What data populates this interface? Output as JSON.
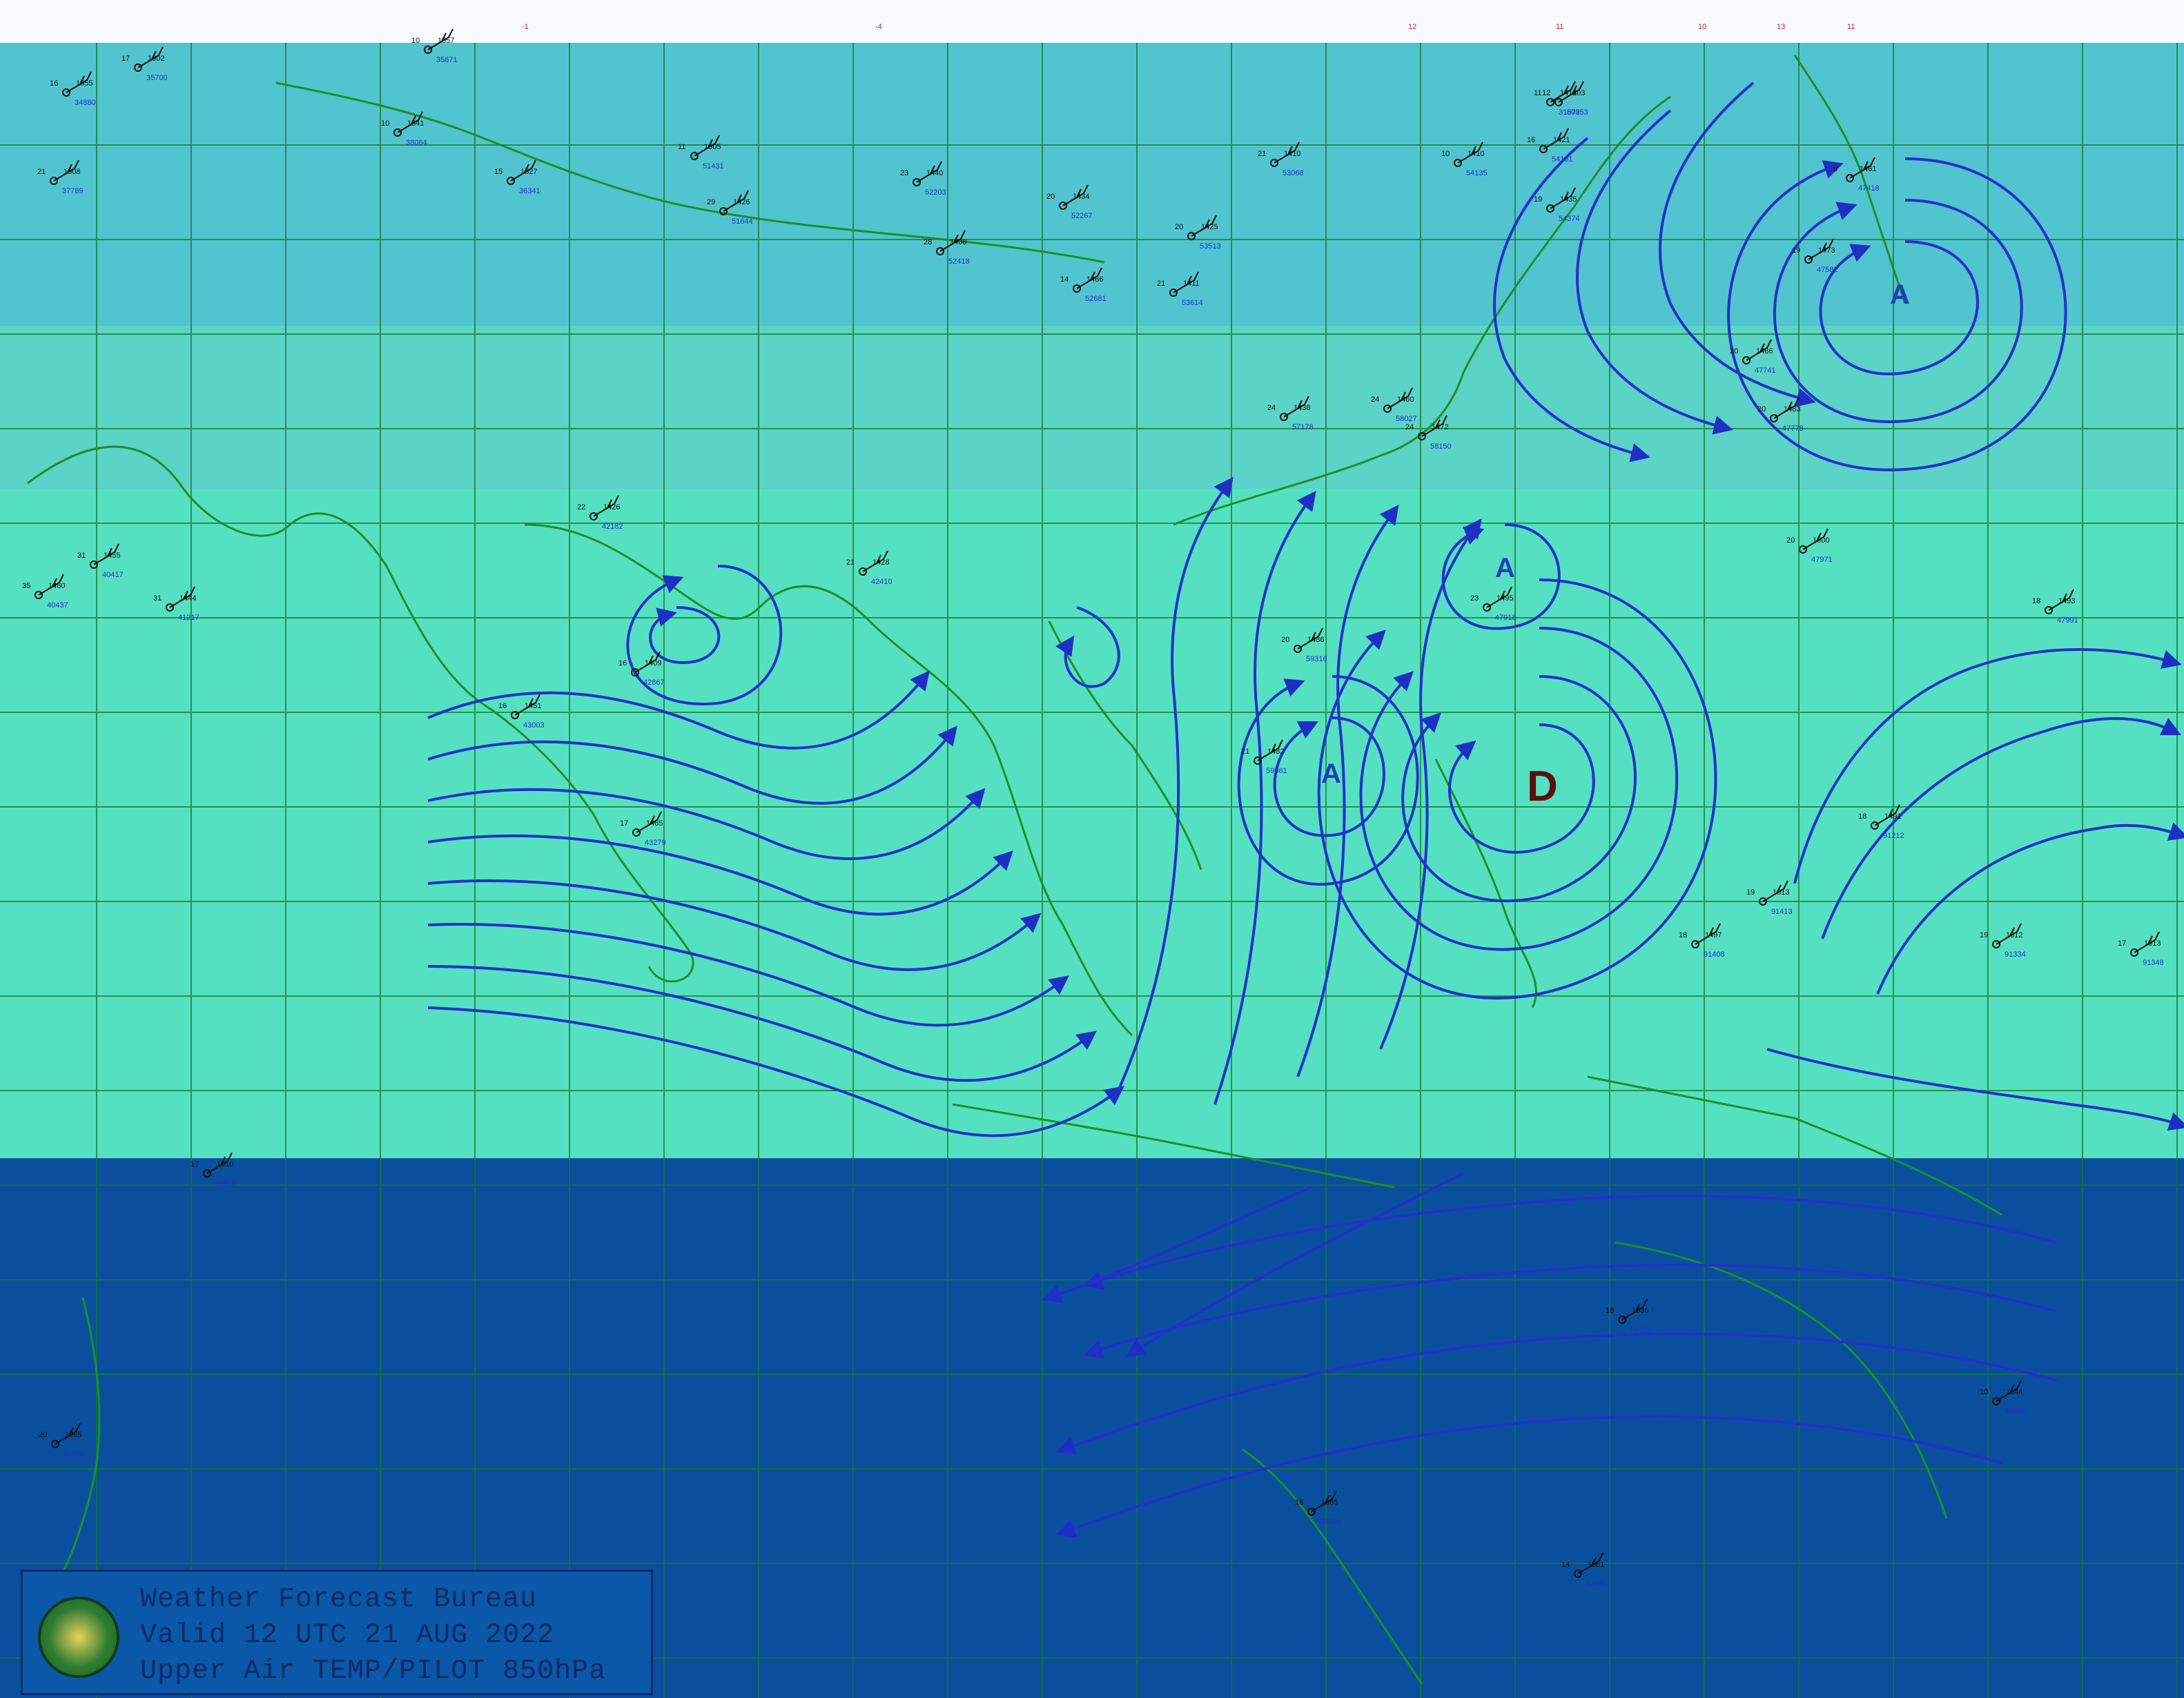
{
  "map": {
    "legend": {
      "line1": "Weather Forecast Bureau",
      "line2": "Valid 12 UTC 21 AUG 2022",
      "line3": "Upper Air TEMP/PILOT 850hPa"
    },
    "pressure_centers": [
      {
        "label": "A",
        "kind": "high",
        "color": "#1f3fb8"
      },
      {
        "label": "A",
        "kind": "high",
        "color": "#1f3fb8"
      },
      {
        "label": "A",
        "kind": "high",
        "color": "#1f3fb8"
      },
      {
        "label": "D",
        "kind": "low",
        "color": "#5a1010"
      }
    ],
    "station_plots": [
      {
        "temp": "17",
        "height": "1602",
        "id": "35700"
      },
      {
        "temp": "10",
        "height": "1557",
        "id": "35671"
      },
      {
        "temp": "16",
        "height": "1555",
        "id": "34880"
      },
      {
        "temp": "21",
        "height": "1508",
        "id": "37789"
      },
      {
        "temp": "10",
        "height": "1541",
        "id": "38064"
      },
      {
        "temp": "15",
        "height": "1527",
        "id": "36341"
      },
      {
        "temp": "11",
        "height": "1505",
        "id": "51431"
      },
      {
        "temp": "23",
        "height": "1440",
        "id": "52203"
      },
      {
        "temp": "29",
        "height": "1426",
        "id": "51644"
      },
      {
        "temp": "20",
        "height": "1434",
        "id": "52267"
      },
      {
        "temp": "28",
        "height": "1408",
        "id": "52418"
      },
      {
        "temp": "21",
        "height": "1410",
        "id": "53068"
      },
      {
        "temp": "20",
        "height": "1425",
        "id": "53513"
      },
      {
        "temp": "14",
        "height": "1466",
        "id": "52681"
      },
      {
        "temp": "21",
        "height": "1411",
        "id": "53614"
      },
      {
        "temp": "12",
        "height": "1403",
        "id": "50953"
      },
      {
        "temp": "16",
        "height": "1421",
        "id": "54161"
      },
      {
        "temp": "10",
        "height": "1410",
        "id": "54135"
      },
      {
        "temp": "19",
        "height": "1435",
        "id": "54374"
      },
      {
        "temp": "11",
        "height": "1412",
        "id": "31873"
      },
      {
        "temp": "6",
        "height": "1461",
        "id": "47418"
      },
      {
        "temp": "19",
        "height": "1473",
        "id": "47582"
      },
      {
        "temp": "24",
        "height": "1460",
        "id": "58027"
      },
      {
        "temp": "24",
        "height": "1472",
        "id": "58150"
      },
      {
        "temp": "24",
        "height": "1438",
        "id": "57178"
      },
      {
        "temp": "20",
        "height": "1466",
        "id": "47741"
      },
      {
        "temp": "20",
        "height": "1483",
        "id": "47778"
      },
      {
        "temp": "22",
        "height": "1426",
        "id": "42182"
      },
      {
        "temp": "21",
        "height": "1428",
        "id": "42410"
      },
      {
        "temp": "16",
        "height": "1409",
        "id": "42867"
      },
      {
        "temp": "17",
        "height": "1465",
        "id": "43279"
      },
      {
        "temp": "16",
        "height": "1451",
        "id": "43003"
      },
      {
        "temp": "31",
        "height": "1455",
        "id": "40417"
      },
      {
        "temp": "31",
        "height": "1444",
        "id": "41217"
      },
      {
        "temp": "35",
        "height": "1480",
        "id": "40437"
      },
      {
        "temp": "21",
        "height": "1482",
        "id": "59981"
      },
      {
        "temp": "20",
        "height": "1486",
        "id": "59316"
      },
      {
        "temp": "20",
        "height": "1500",
        "id": "47971"
      },
      {
        "temp": "18",
        "height": "1493",
        "id": "47991"
      },
      {
        "temp": "18",
        "height": "1491",
        "id": "91212"
      },
      {
        "temp": "19",
        "height": "1513",
        "id": "91413"
      },
      {
        "temp": "19",
        "height": "1512",
        "id": "91334"
      },
      {
        "temp": "17",
        "height": "1513",
        "id": "91348"
      },
      {
        "temp": "18",
        "height": "1497",
        "id": "91408"
      },
      {
        "temp": "23",
        "height": "1495",
        "id": "47918"
      },
      {
        "temp": "17",
        "height": "1510",
        "id": "68816"
      },
      {
        "temp": "20",
        "height": "1555",
        "id": "61980"
      },
      {
        "temp": "16",
        "height": "1585",
        "id": "94203"
      },
      {
        "temp": "14",
        "height": "1561",
        "id": "94461"
      },
      {
        "temp": "10",
        "height": "1544",
        "id": "94866"
      },
      {
        "temp": "18",
        "height": "1536",
        "id": "94332"
      }
    ],
    "top_strip_red": [
      "-1",
      "-4",
      "12",
      "11",
      "10",
      "13",
      "11"
    ],
    "colors": {
      "north_band": "#52c4cf",
      "mid_band": "#5bd3c6",
      "tropic_band": "#55e1c1",
      "south_band": "#0a4f9e",
      "coastline": "#1b8f2a",
      "streamline": "#2232c8",
      "grid": "#147a2a"
    }
  }
}
